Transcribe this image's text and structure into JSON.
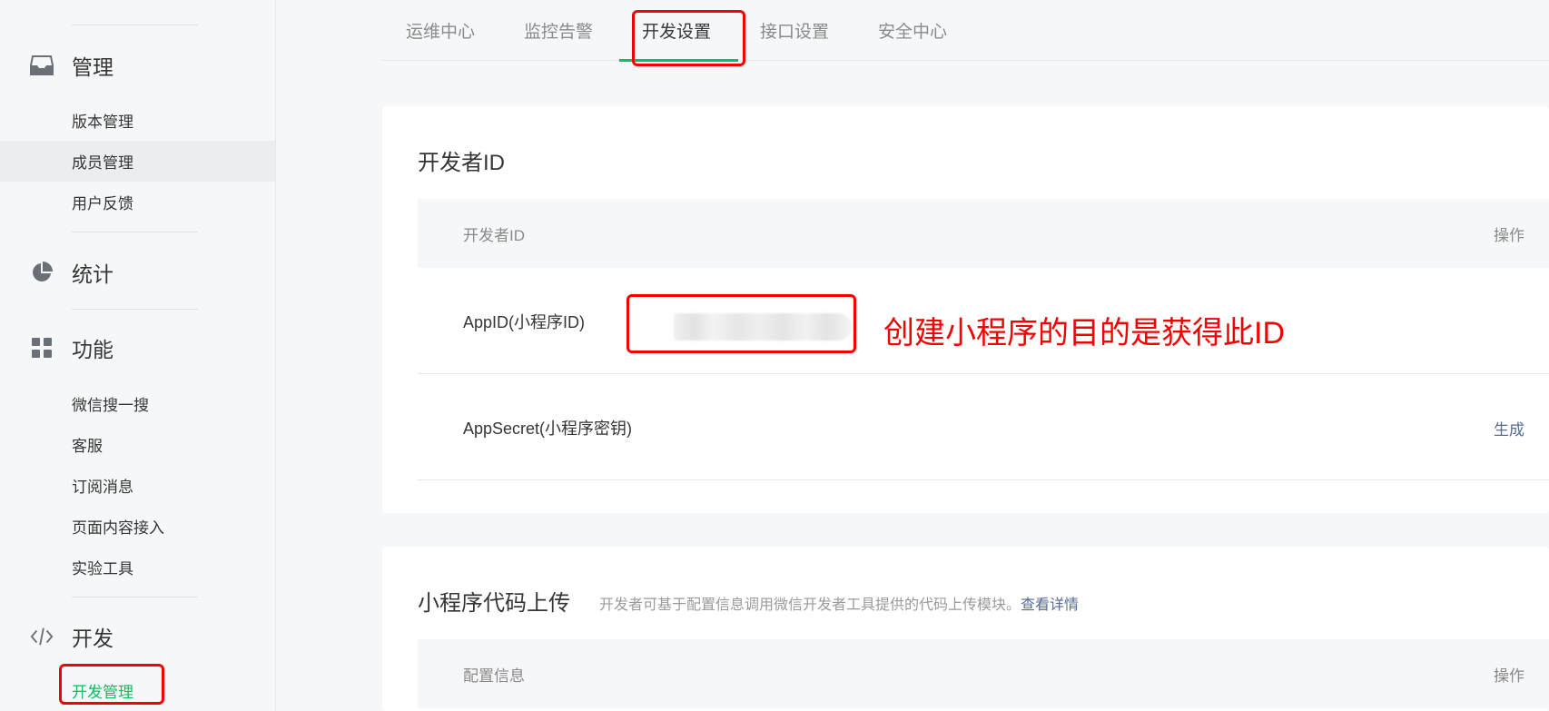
{
  "sidebar": {
    "sections": [
      {
        "label": "管理",
        "icon": "inbox-icon"
      },
      {
        "label": "统计",
        "icon": "pie-chart-icon"
      },
      {
        "label": "功能",
        "icon": "grid-icon"
      },
      {
        "label": "开发",
        "icon": "code-icon"
      }
    ],
    "manage_items": [
      "版本管理",
      "成员管理",
      "用户反馈"
    ],
    "feature_items": [
      "微信搜一搜",
      "客服",
      "订阅消息",
      "页面内容接入",
      "实验工具"
    ],
    "dev_items": [
      "开发管理"
    ]
  },
  "tabs": [
    "运维中心",
    "监控告警",
    "开发设置",
    "接口设置",
    "安全中心"
  ],
  "active_tab": "开发设置",
  "developer_id_card": {
    "title": "开发者ID",
    "columns": {
      "name": "开发者ID",
      "action": "操作"
    },
    "rows": [
      {
        "key": "AppID(小程序ID)",
        "value_state": "blurred"
      },
      {
        "key": "AppSecret(小程序密钥)",
        "action": "生成"
      }
    ]
  },
  "upload_card": {
    "title": "小程序代码上传",
    "subtitle": "开发者可基于配置信息调用微信开发者工具提供的代码上传模块。",
    "link": "查看详情",
    "columns": {
      "name": "配置信息",
      "action": "操作"
    }
  },
  "annotation": {
    "note": "创建小程序的目的是获得此ID",
    "color": "#f50000"
  },
  "colors": {
    "accent": "#07c160",
    "link": "#576b95",
    "annotation": "#f50000"
  }
}
